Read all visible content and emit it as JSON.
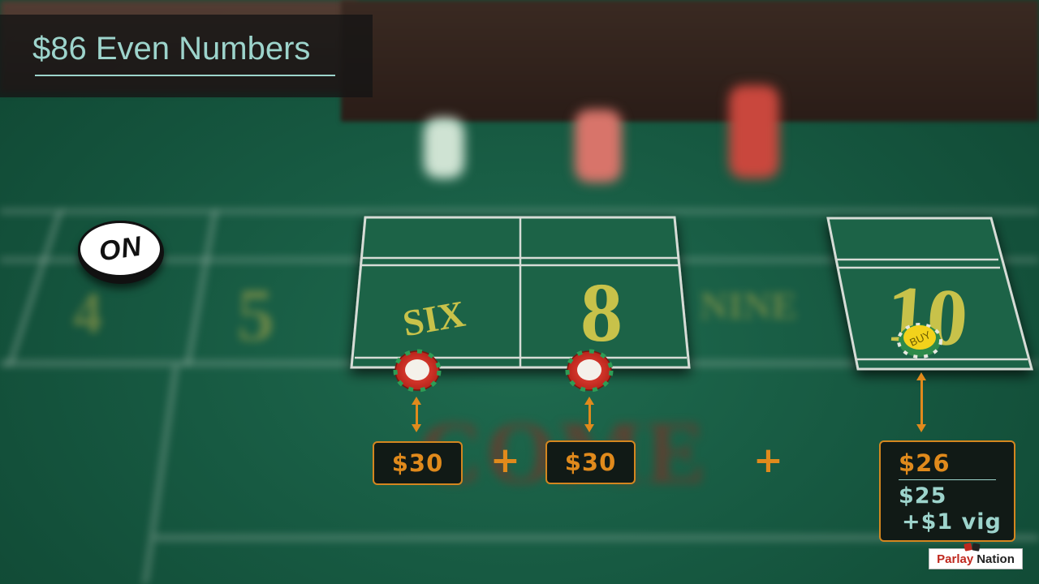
{
  "title": "$86 Even Numbers",
  "puck": {
    "label": "ON"
  },
  "table": {
    "six_label": "SIX",
    "eight_label": "8",
    "ten_label": "10",
    "buy_chip_label": "BUY",
    "come_label": "COME"
  },
  "bets": {
    "six_amount": "$30",
    "eight_amount": "$30",
    "plus_sign": "+",
    "ten_total": "$26",
    "ten_bet": "$25",
    "ten_vig": "+$1 vig"
  },
  "logo": {
    "part1": "Parlay",
    "part2": "Nation"
  },
  "colors": {
    "felt": "#1f5f47",
    "accent_orange": "#e08a1c",
    "title_text": "#9dd4cc",
    "chip_red": "#d9342b",
    "chip_green": "#2e9c55",
    "buy_chip_yellow": "#f3d21b"
  }
}
